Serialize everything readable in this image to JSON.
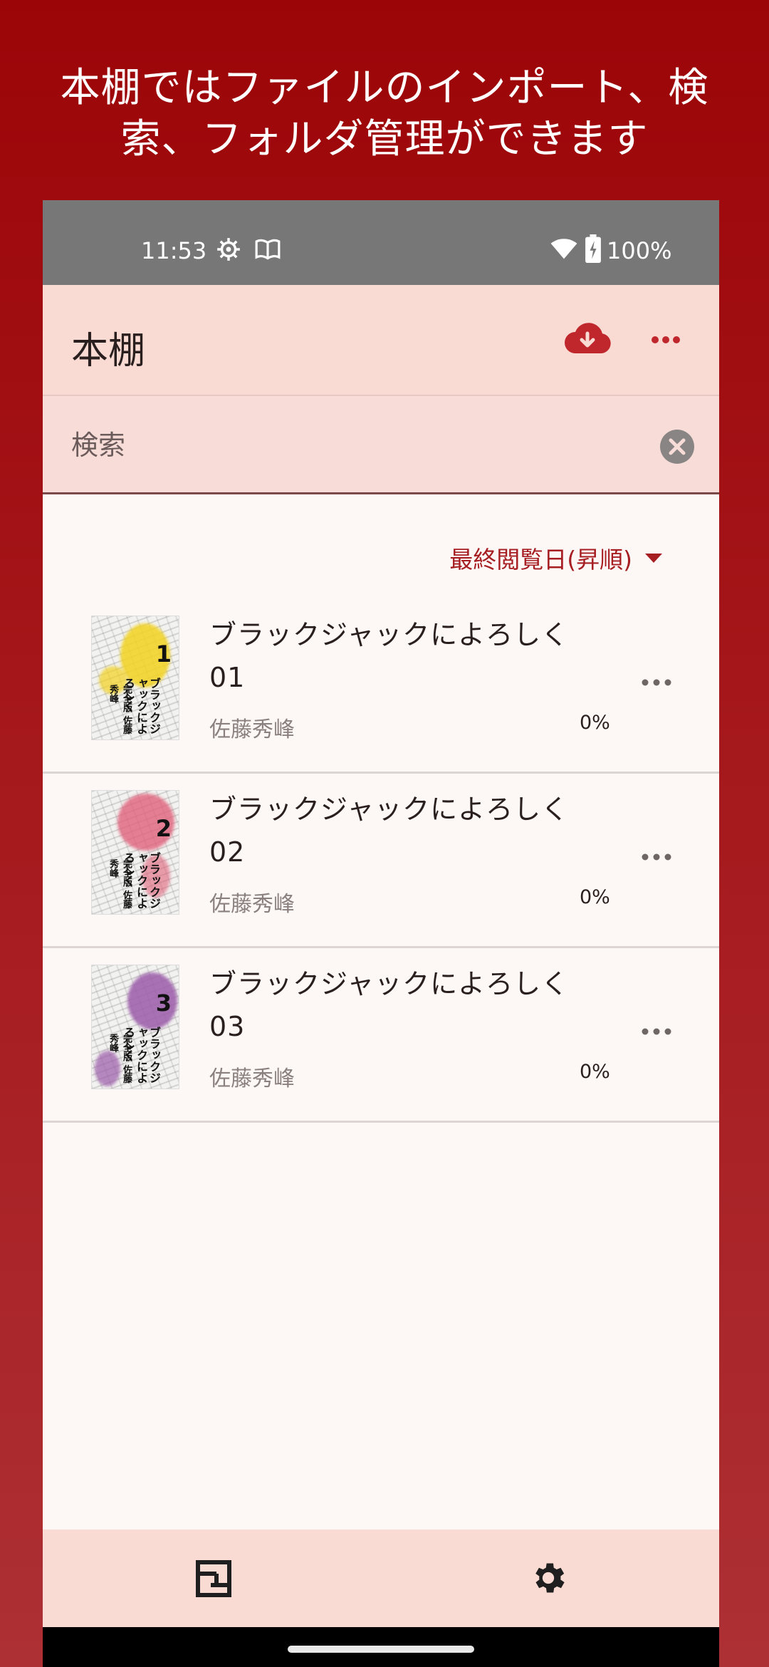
{
  "promo": {
    "line1": "本棚ではファイルのインポート、検",
    "line2": "索、フォルダ管理ができます"
  },
  "status_bar": {
    "time": "11:53",
    "battery": "100%",
    "icons": [
      "settings-gear-icon",
      "book-icon",
      "wifi-icon",
      "battery-charging-icon"
    ]
  },
  "app_bar": {
    "title": "本棚",
    "actions": [
      "cloud-download-icon",
      "more-horizontal-icon"
    ],
    "accent_color": "#c0272d"
  },
  "search": {
    "placeholder": "検索",
    "value": ""
  },
  "sort": {
    "label": "最終閲覧日(昇順)",
    "color": "#a61d22"
  },
  "books": [
    {
      "title": "ブラックジャックによろしく 01",
      "author": "佐藤秀峰",
      "progress": "0%",
      "cover_volume": "1",
      "cover_color": "#f2d21e",
      "cover_title": "ブラックジャックによろしく",
      "cover_sub": "完全版 佐藤秀峰"
    },
    {
      "title": "ブラックジャックによろしく 02",
      "author": "佐藤秀峰",
      "progress": "0%",
      "cover_volume": "2",
      "cover_color": "#e0607a",
      "cover_title": "ブラックジャックによろしく",
      "cover_sub": "完全版 佐藤秀峰"
    },
    {
      "title": "ブラックジャックによろしく 03",
      "author": "佐藤秀峰",
      "progress": "0%",
      "cover_volume": "3",
      "cover_color": "#9a5aa8",
      "cover_title": "ブラックジャックによろしく",
      "cover_sub": "完全版 佐藤秀峰"
    }
  ],
  "bottom_nav": {
    "items": [
      "bookshelf-icon",
      "settings-icon"
    ]
  }
}
